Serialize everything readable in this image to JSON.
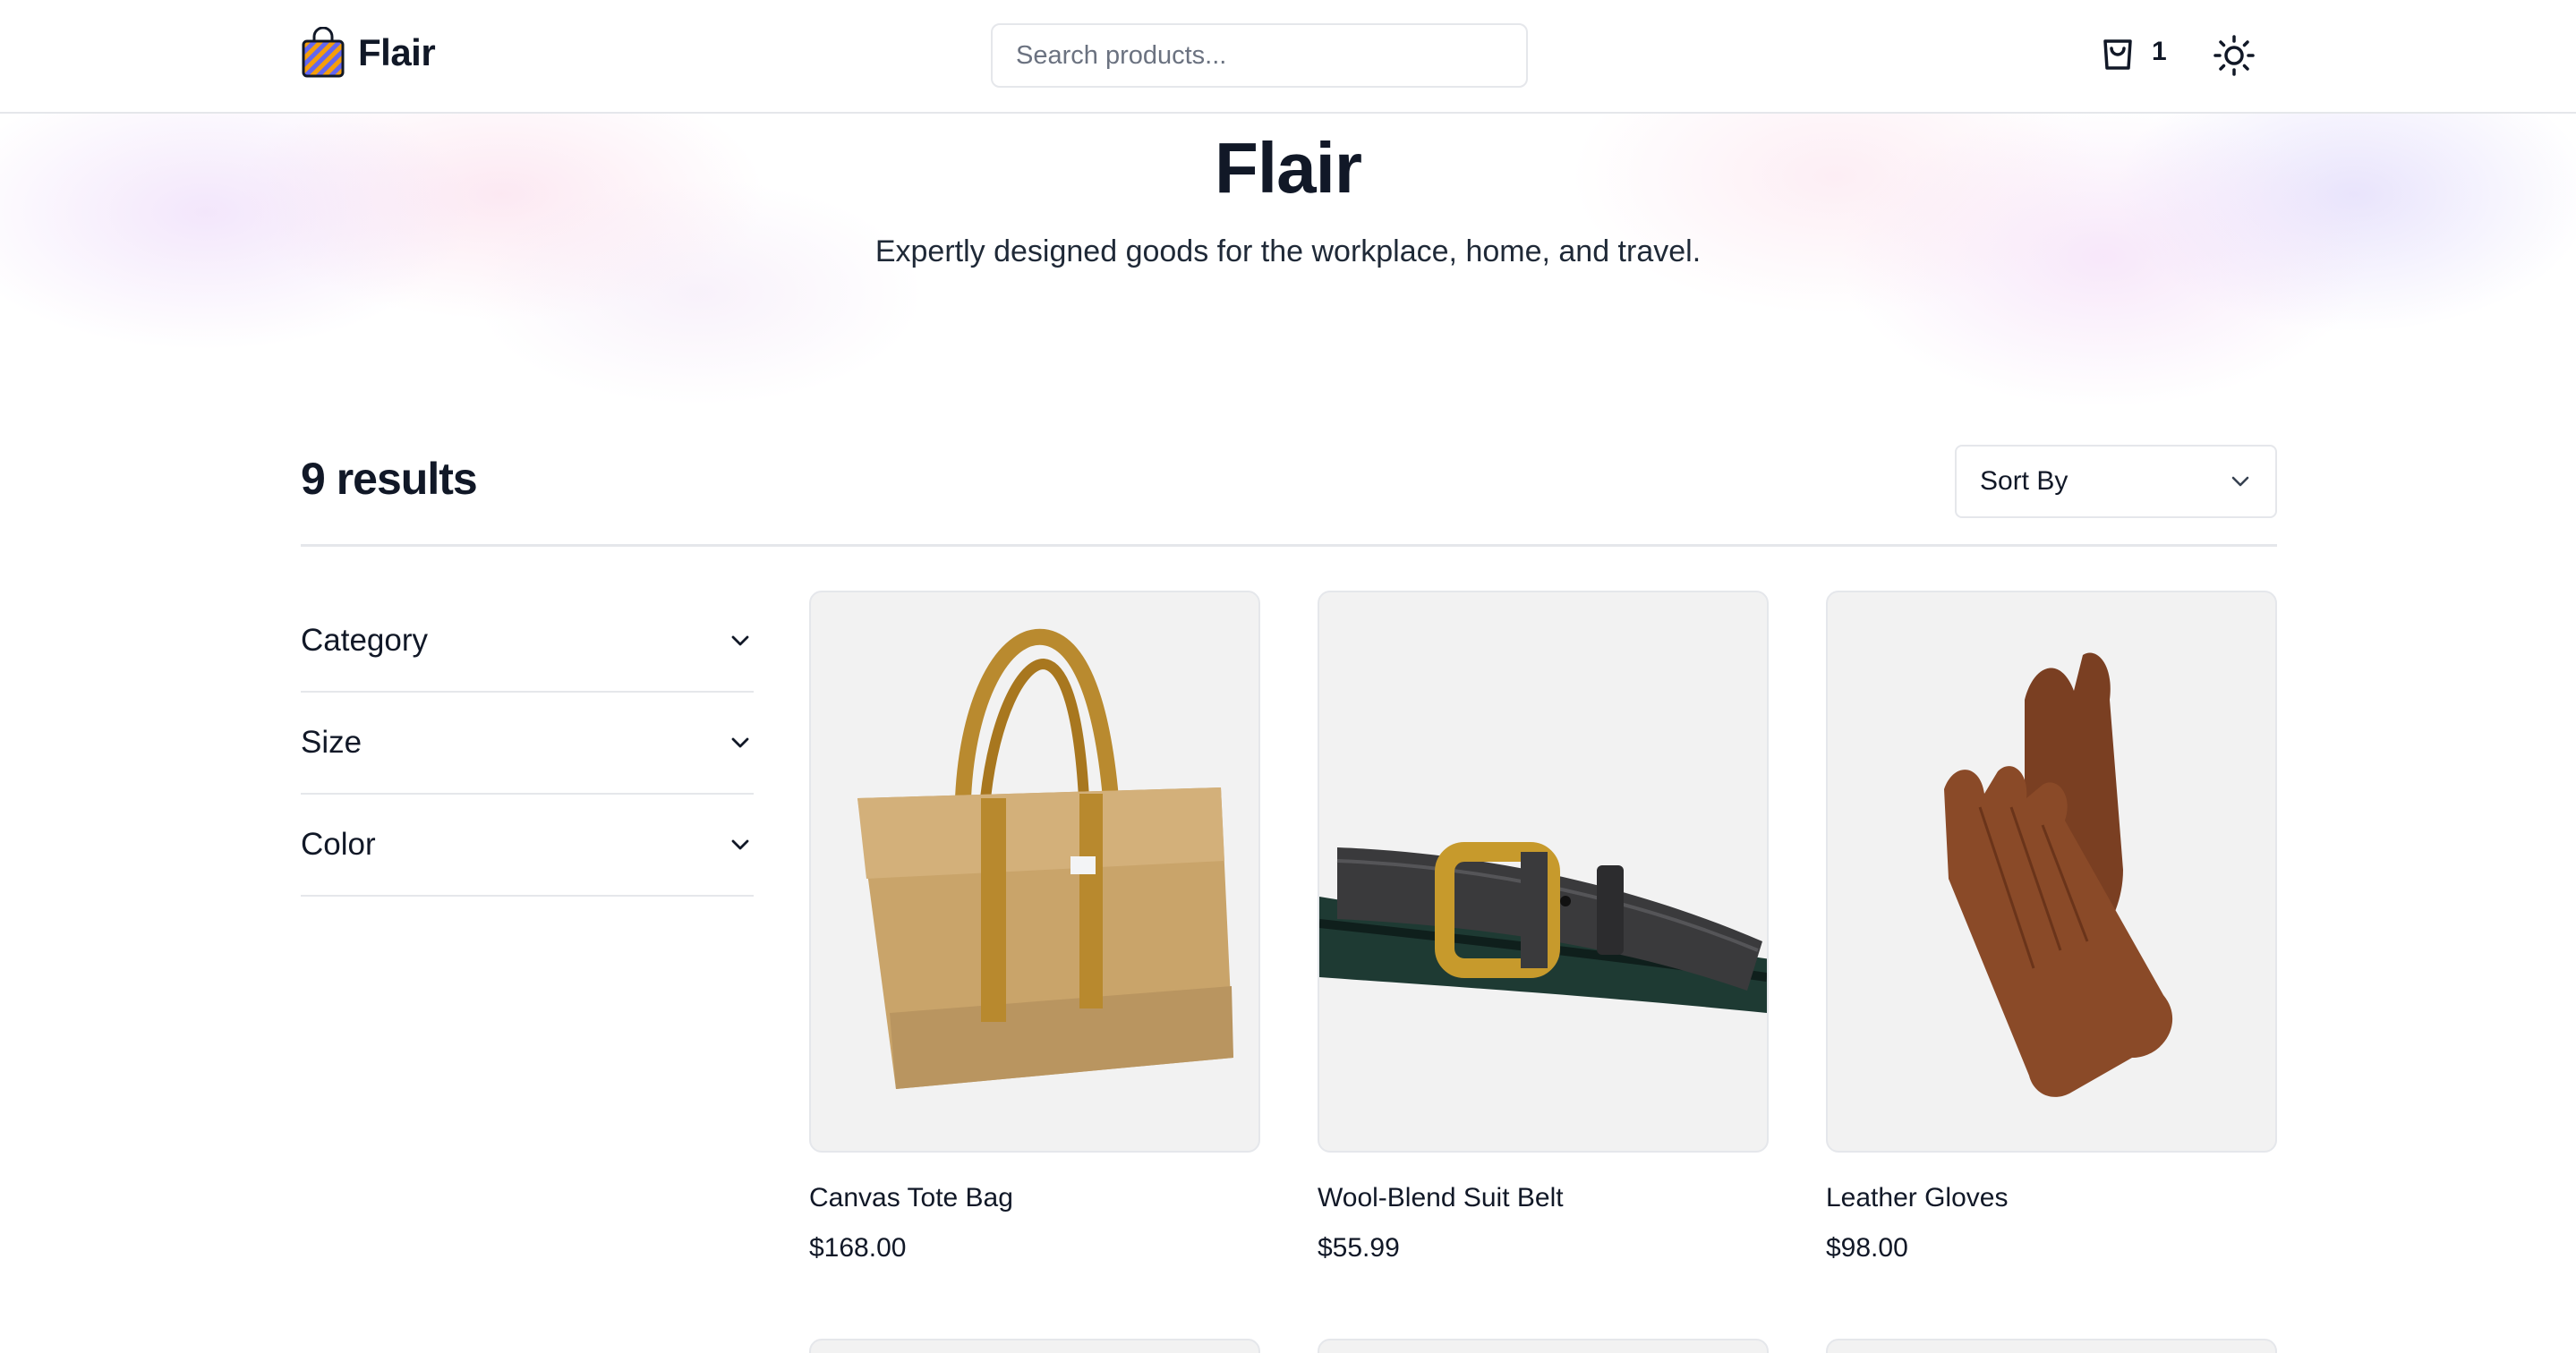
{
  "header": {
    "logo_text": "Flair",
    "search_placeholder": "Search products...",
    "cart_count": "1"
  },
  "hero": {
    "title": "Flair",
    "subtitle": "Expertly designed goods for the workplace, home, and travel."
  },
  "results": {
    "count_label": "9 results",
    "sort_label": "Sort By"
  },
  "filters": [
    {
      "label": "Category"
    },
    {
      "label": "Size"
    },
    {
      "label": "Color"
    }
  ],
  "products": [
    {
      "name": "Canvas Tote Bag",
      "price": "$168.00",
      "image": "canvas-tote-bag"
    },
    {
      "name": "Wool-Blend Suit Belt",
      "price": "$55.99",
      "image": "wool-blend-suit-belt"
    },
    {
      "name": "Leather Gloves",
      "price": "$98.00",
      "image": "leather-gloves"
    }
  ],
  "icons": {
    "logo": "shopping-bag-icon",
    "cart": "cart-icon",
    "theme": "sun-icon",
    "chevron": "chevron-down-icon"
  }
}
